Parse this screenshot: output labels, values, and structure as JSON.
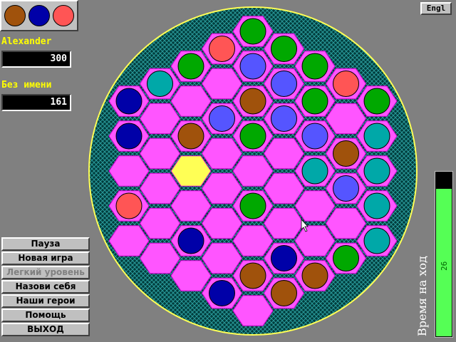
{
  "next_balls": [
    "#a0520c",
    "#0000a8",
    "#ff5555"
  ],
  "players": [
    {
      "name": "Alexander",
      "score": "300"
    },
    {
      "name": "Без имени",
      "score": "161"
    }
  ],
  "menu": [
    {
      "label": "Пауза",
      "enabled": true
    },
    {
      "label": "Новая игра",
      "enabled": true
    },
    {
      "label": "Легкий уровень",
      "enabled": false
    },
    {
      "label": "Назови себя",
      "enabled": true
    },
    {
      "label": "Наши герои",
      "enabled": true
    },
    {
      "label": "Помощь",
      "enabled": true
    },
    {
      "label": "ВЫХОД",
      "enabled": true
    }
  ],
  "language_button": "Engl",
  "timer": {
    "label": "Время на ход",
    "value": "26",
    "fraction": 0.9
  },
  "colors": {
    "brown": "#a0520c",
    "navy": "#0000a8",
    "red": "#ff5555",
    "green": "#00a800",
    "blue": "#5555ff",
    "teal": "#00a8a8",
    "cell": "#ff55ff",
    "selected": "#ffff55",
    "rim": "#ffff55",
    "board_bg": "#003838"
  },
  "board": {
    "columns": [
      {
        "col": 0,
        "rows": 5
      },
      {
        "col": 1,
        "rows": 6
      },
      {
        "col": 2,
        "rows": 7
      },
      {
        "col": 3,
        "rows": 8
      },
      {
        "col": 4,
        "rows": 9
      },
      {
        "col": 5,
        "rows": 8
      },
      {
        "col": 6,
        "rows": 7
      },
      {
        "col": 7,
        "rows": 6
      },
      {
        "col": 8,
        "rows": 5
      }
    ],
    "selected_cell": {
      "col": 2,
      "row": 3
    },
    "balls": [
      {
        "col": 0,
        "row": 0,
        "color": "navy"
      },
      {
        "col": 0,
        "row": 1,
        "color": "navy"
      },
      {
        "col": 0,
        "row": 3,
        "color": "red"
      },
      {
        "col": 1,
        "row": 0,
        "color": "teal"
      },
      {
        "col": 2,
        "row": 0,
        "color": "green"
      },
      {
        "col": 2,
        "row": 2,
        "color": "brown"
      },
      {
        "col": 2,
        "row": 5,
        "color": "navy"
      },
      {
        "col": 3,
        "row": 0,
        "color": "red"
      },
      {
        "col": 3,
        "row": 2,
        "color": "blue"
      },
      {
        "col": 3,
        "row": 7,
        "color": "navy"
      },
      {
        "col": 4,
        "row": 0,
        "color": "green"
      },
      {
        "col": 4,
        "row": 1,
        "color": "blue"
      },
      {
        "col": 4,
        "row": 2,
        "color": "brown"
      },
      {
        "col": 4,
        "row": 3,
        "color": "green"
      },
      {
        "col": 4,
        "row": 5,
        "color": "green"
      },
      {
        "col": 4,
        "row": 7,
        "color": "brown"
      },
      {
        "col": 5,
        "row": 0,
        "color": "green"
      },
      {
        "col": 5,
        "row": 1,
        "color": "blue"
      },
      {
        "col": 5,
        "row": 2,
        "color": "blue"
      },
      {
        "col": 5,
        "row": 6,
        "color": "navy"
      },
      {
        "col": 5,
        "row": 7,
        "color": "brown"
      },
      {
        "col": 6,
        "row": 0,
        "color": "green"
      },
      {
        "col": 6,
        "row": 1,
        "color": "green"
      },
      {
        "col": 6,
        "row": 2,
        "color": "blue"
      },
      {
        "col": 6,
        "row": 3,
        "color": "teal"
      },
      {
        "col": 6,
        "row": 6,
        "color": "brown"
      },
      {
        "col": 7,
        "row": 0,
        "color": "red"
      },
      {
        "col": 7,
        "row": 2,
        "color": "brown"
      },
      {
        "col": 7,
        "row": 3,
        "color": "blue"
      },
      {
        "col": 7,
        "row": 5,
        "color": "green"
      },
      {
        "col": 8,
        "row": 0,
        "color": "green"
      },
      {
        "col": 8,
        "row": 1,
        "color": "teal"
      },
      {
        "col": 8,
        "row": 2,
        "color": "teal"
      },
      {
        "col": 8,
        "row": 3,
        "color": "teal"
      },
      {
        "col": 8,
        "row": 4,
        "color": "teal"
      }
    ]
  }
}
